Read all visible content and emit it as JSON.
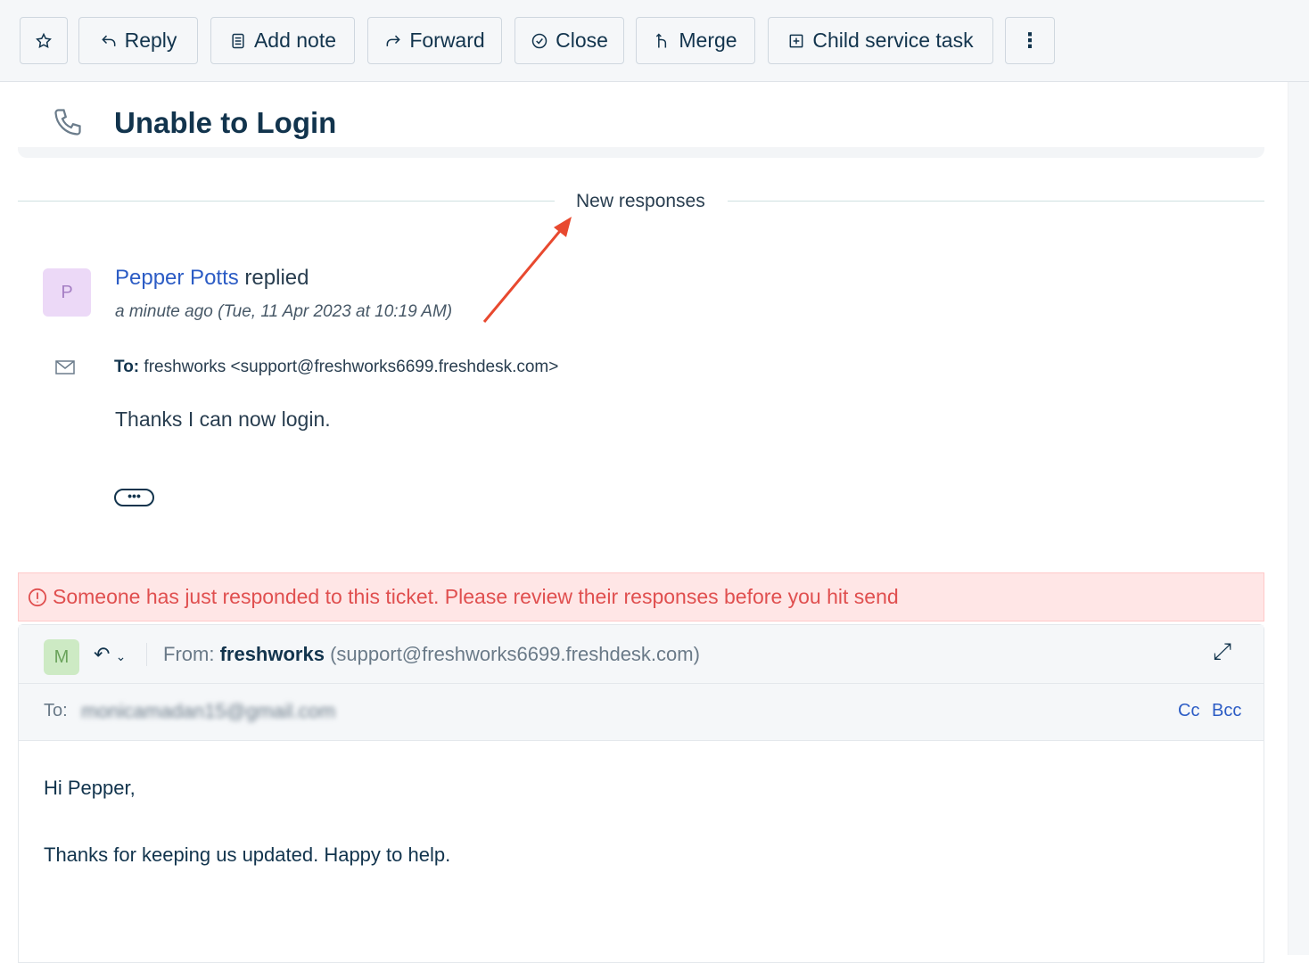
{
  "toolbar": {
    "reply": "Reply",
    "add_note": "Add note",
    "forward": "Forward",
    "close": "Close",
    "merge": "Merge",
    "child_task": "Child service task"
  },
  "ticket": {
    "title": "Unable to Login"
  },
  "divider_label": "New responses",
  "response": {
    "avatar": "P",
    "sender": "Pepper Potts",
    "action": "replied",
    "time": "a minute ago (Tue, 11 Apr 2023 at 10:19 AM)",
    "to_label": "To:",
    "to_value": "freshworks <support@freshworks6699.freshdesk.com>",
    "body": "Thanks I can now login.",
    "more": "•••"
  },
  "alert": {
    "text": "Someone has just responded to this ticket. Please review their responses before you hit send",
    "color": "#e04f4f"
  },
  "composer": {
    "avatar": "M",
    "from_label": "From:",
    "from_name": "freshworks",
    "from_email": "(support@freshworks6699.freshdesk.com)",
    "to_label": "To:",
    "to_value": "monicamadan15@gmail.com",
    "cc": "Cc",
    "bcc": "Bcc",
    "greeting": "Hi Pepper,",
    "body": "Thanks for keeping us updated. Happy to help."
  },
  "colors": {
    "link": "#2c5cc5",
    "annotation_arrow": "#e8492f"
  }
}
